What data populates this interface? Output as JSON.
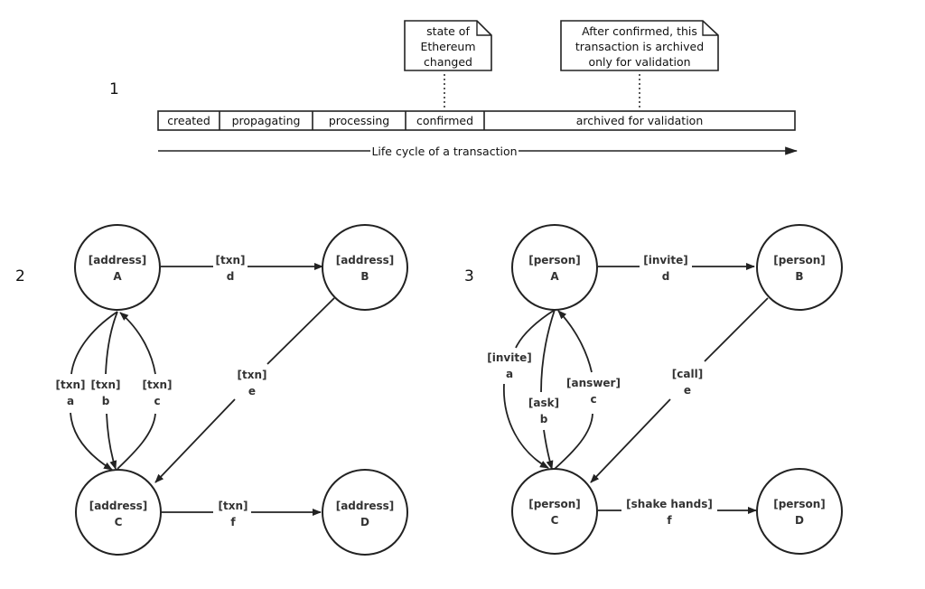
{
  "section1": {
    "number": "1",
    "stages": [
      "created",
      "propagating",
      "processing",
      "confirmed",
      "archived for validation"
    ],
    "notes": [
      {
        "lines": [
          "state of",
          "Ethereum",
          "changed"
        ],
        "attached_stage": "confirmed"
      },
      {
        "lines": [
          "After confirmed,  this",
          "transaction is archived",
          "only for validation"
        ],
        "attached_stage": "archived for validation"
      }
    ],
    "axis_label": "Life cycle of a transaction"
  },
  "section2": {
    "number": "2",
    "nodes": [
      {
        "id": "A",
        "type": "[address]",
        "name": "A"
      },
      {
        "id": "B",
        "type": "[address]",
        "name": "B"
      },
      {
        "id": "C",
        "type": "[address]",
        "name": "C"
      },
      {
        "id": "D",
        "type": "[address]",
        "name": "D"
      }
    ],
    "edges": [
      {
        "from": "A",
        "to": "B",
        "label": "[txn]",
        "id": "d"
      },
      {
        "from": "A",
        "to": "C",
        "label": "[txn]",
        "id": "a"
      },
      {
        "from": "A",
        "to": "C",
        "label": "[txn]",
        "id": "b"
      },
      {
        "from": "C",
        "to": "A",
        "label": "[txn]",
        "id": "c"
      },
      {
        "from": "B",
        "to": "C",
        "label": "[txn]",
        "id": "e"
      },
      {
        "from": "C",
        "to": "D",
        "label": "[txn]",
        "id": "f"
      }
    ]
  },
  "section3": {
    "number": "3",
    "nodes": [
      {
        "id": "A",
        "type": "[person]",
        "name": "A"
      },
      {
        "id": "B",
        "type": "[person]",
        "name": "B"
      },
      {
        "id": "C",
        "type": "[person]",
        "name": "C"
      },
      {
        "id": "D",
        "type": "[person]",
        "name": "D"
      }
    ],
    "edges": [
      {
        "from": "A",
        "to": "B",
        "label": "[invite]",
        "id": "d"
      },
      {
        "from": "A",
        "to": "C",
        "label": "[invite]",
        "id": "a"
      },
      {
        "from": "A",
        "to": "C",
        "label": "[ask]",
        "id": "b"
      },
      {
        "from": "C",
        "to": "A",
        "label": "[answer]",
        "id": "c"
      },
      {
        "from": "B",
        "to": "C",
        "label": "[call]",
        "id": "e"
      },
      {
        "from": "C",
        "to": "D",
        "label": "[shake hands]",
        "id": "f"
      }
    ]
  },
  "colors": {
    "stroke": "#222222",
    "text": "#333333",
    "background": "#ffffff"
  }
}
